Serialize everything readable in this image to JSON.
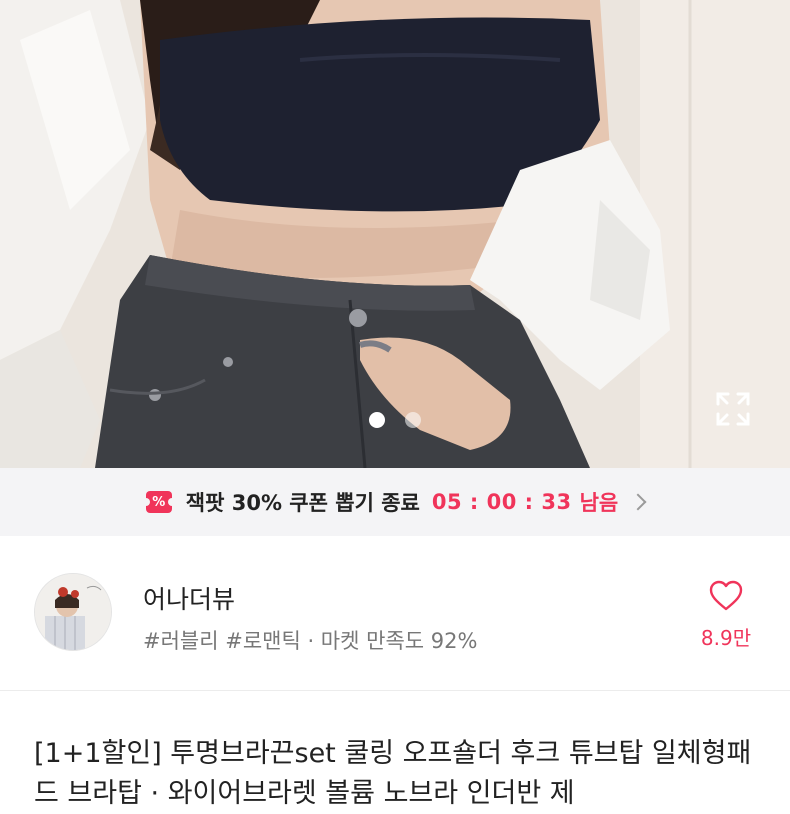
{
  "gallery": {
    "image_description_icon": "product-photo",
    "total_slides": 2,
    "active_slide": 1,
    "expand_icon": "expand-icon"
  },
  "coupon": {
    "icon": "coupon-icon",
    "icon_text": "%",
    "text": "잭팟 30% 쿠폰 뽑기 종료",
    "timer": "05 : 00 : 33",
    "remain_label": "남음",
    "accent_color": "#f0345a"
  },
  "shop": {
    "name": "어나더뷰",
    "tags": "#러블리 #로맨틱 · 마켓 만족도 92%",
    "like_icon": "heart-icon",
    "like_count": "8.9만"
  },
  "product": {
    "title": "[1+1할인] 투명브라끈set 쿨링 오프숄더 후크 튜브탑 일체형패드 브라탑 · 와이어브라렛 볼륨 노브라 인더반 제"
  }
}
